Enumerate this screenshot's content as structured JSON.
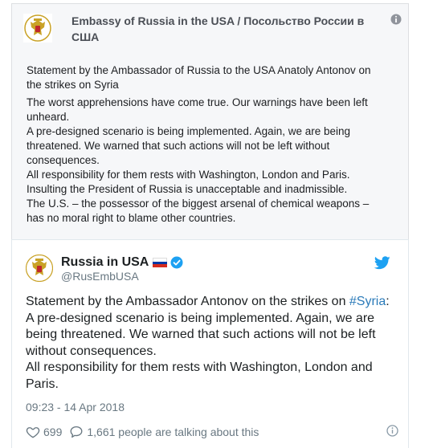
{
  "facebook_post": {
    "page_name": "Embassy of Russia in the USA / Посольство России в США",
    "avatar_icon": "russian-coat-of-arms-icon",
    "info_icon": "info-icon",
    "paragraphs": [
      [
        "Statement by the Ambassador of Russia to the USA Anatoly Antonov on",
        "the strikes on Syria"
      ],
      [
        "The worst apprehensions have come true. Our warnings have been left",
        "unheard.",
        "A pre-designed scenario is being implemented. Again, we are being",
        "threatened. We warned that such actions will not be left without",
        "consequences.",
        "All responsibility for them rests with Washington, London and Paris.",
        "Insulting the President of Russia is unacceptable and inadmissible.",
        "The U.S. – the possessor of the biggest arsenal of chemical weapons –",
        "has no moral right to blame other countries."
      ]
    ]
  },
  "tweet": {
    "display_name": "Russia in USA",
    "handle": "@RusEmbUSA",
    "flag_icon": "russia-flag-icon",
    "verified_icon": "verified-badge-icon",
    "bird_icon": "twitter-bird-icon",
    "line1_prefix": "Statement by the Ambassador Antonov on the strikes on ",
    "hashtag": "#Syria",
    "line1_suffix": ":",
    "lines": [
      "A pre-designed scenario is being implemented. Again, we are",
      "being threatened. We warned that such actions will not be left",
      "without consequences.",
      "All responsibility for them rests with Washington, London and",
      "Paris."
    ],
    "timestamp": "09:23 - 14 Apr 2018",
    "like_count": "699",
    "talking_text": "1,661 people are talking about this",
    "colors": {
      "link": "#2b7bb9",
      "twitter_blue": "#1da1f2",
      "muted": "#697882"
    }
  }
}
